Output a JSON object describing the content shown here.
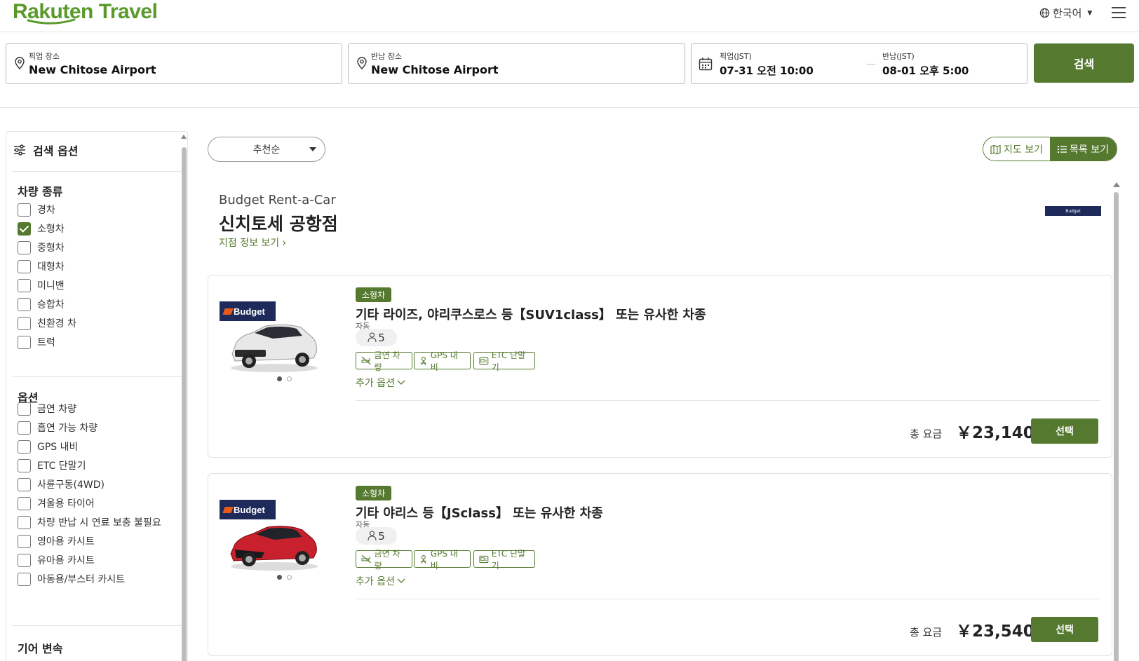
{
  "header": {
    "logo_text": "Rakuten Travel",
    "language": "한국어",
    "brand_color": "#5a9a2a"
  },
  "search": {
    "pickup_place_label": "픽업 장소",
    "pickup_place": "New Chitose Airport",
    "return_place_label": "반납 장소",
    "return_place": "New Chitose Airport",
    "pickup_time_label": "픽업(JST)",
    "pickup_time": "07-31  오전 10:00",
    "return_time_label": "반납(JST)",
    "return_time": "08-01  오후 5:00",
    "search_button": "검색",
    "accent_color": "#557a2f"
  },
  "sidebar": {
    "title": "검색 옵션",
    "vehicle_type_title": "차량 종류",
    "vehicle_types": [
      {
        "label": "경차",
        "checked": false
      },
      {
        "label": "소형차",
        "checked": true
      },
      {
        "label": "중형차",
        "checked": false
      },
      {
        "label": "대형차",
        "checked": false
      },
      {
        "label": "미니밴",
        "checked": false
      },
      {
        "label": "승합차",
        "checked": false
      },
      {
        "label": "친환경 차",
        "checked": false
      },
      {
        "label": "트럭",
        "checked": false
      }
    ],
    "options_title": "옵션",
    "options": [
      {
        "label": "금연 차량",
        "checked": false
      },
      {
        "label": "흡연 가능 차량",
        "checked": false
      },
      {
        "label": "GPS 내비",
        "checked": false
      },
      {
        "label": "ETC 단말기",
        "checked": false
      },
      {
        "label": "사륜구동(4WD)",
        "checked": false
      },
      {
        "label": "겨울용 타이어",
        "checked": false
      },
      {
        "label": "차량 반납 시 연료 보충 불필요",
        "checked": false
      },
      {
        "label": "영아용 카시트",
        "checked": false
      },
      {
        "label": "유아용 카시트",
        "checked": false
      },
      {
        "label": "아동용/부스터 카시트",
        "checked": false
      }
    ],
    "transmission_title": "기어 변속"
  },
  "main": {
    "sort_label": "추천순",
    "map_view": "지도 보기",
    "list_view": "목록 보기",
    "shop_brand": "Budget Rent-a-Car",
    "shop_name": "신치토세 공항점",
    "shop_link": "지점 정보 보기",
    "brand_logo_text": "Budget",
    "cars": [
      {
        "badge": "소형차",
        "title": "기타 라이즈, 야리쿠스로스 등【SUV1class】 또는 유사한 차종",
        "transmission": "자동",
        "seats": "5",
        "features": [
          "금연 차량",
          "GPS 내비",
          "ETC 단말기"
        ],
        "more_options": "추가 옵션",
        "total_label": "총 요금",
        "price": "￥23,140",
        "select": "선택",
        "car_color": "#e8e8e8"
      },
      {
        "badge": "소형차",
        "title": "기타 야리스 등【JSclass】 또는 유사한 차종",
        "transmission": "자동",
        "seats": "5",
        "features": [
          "금연 차량",
          "GPS 내비",
          "ETC 단말기"
        ],
        "more_options": "추가 옵션",
        "total_label": "총 요금",
        "price": "￥23,540",
        "select": "선택",
        "car_color": "#c8202c"
      }
    ]
  }
}
